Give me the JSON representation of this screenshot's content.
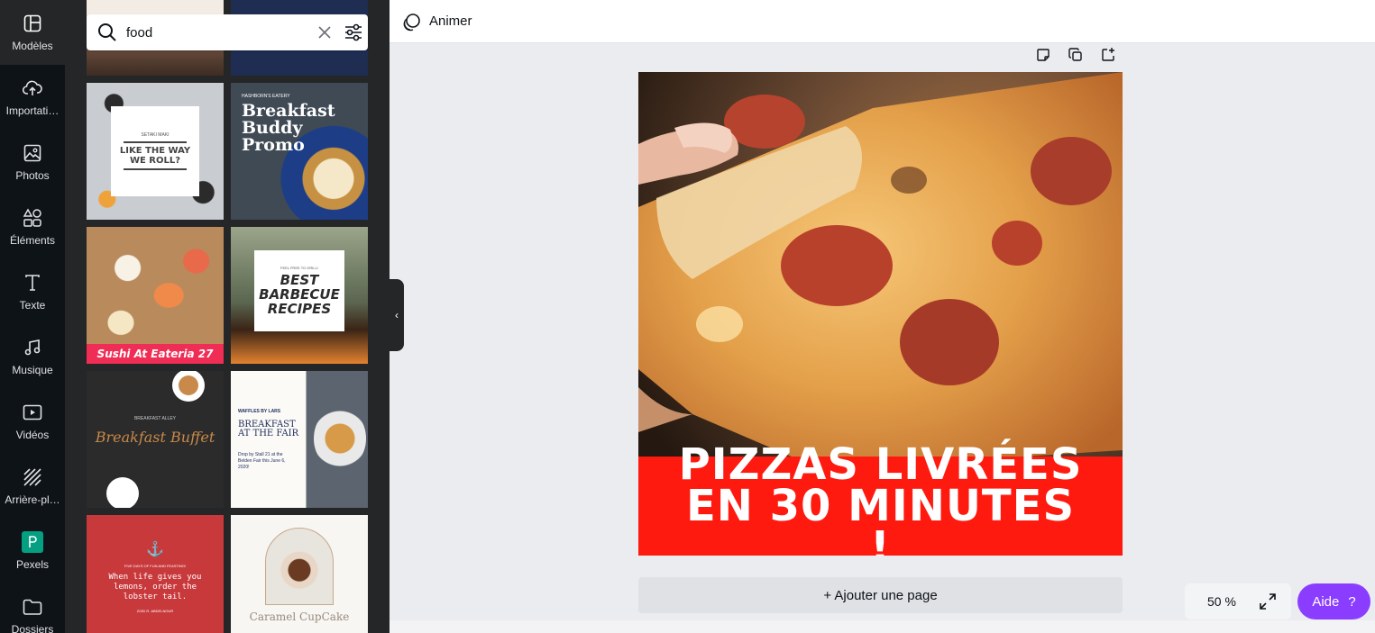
{
  "nav": {
    "items": [
      {
        "label": "Modèles",
        "icon": "templates-icon"
      },
      {
        "label": "Importati…",
        "icon": "upload-cloud-icon"
      },
      {
        "label": "Photos",
        "icon": "image-icon"
      },
      {
        "label": "Éléments",
        "icon": "shapes-icon"
      },
      {
        "label": "Texte",
        "icon": "text-icon"
      },
      {
        "label": "Musique",
        "icon": "music-icon"
      },
      {
        "label": "Vidéos",
        "icon": "video-icon"
      },
      {
        "label": "Arrière-pl…",
        "icon": "background-icon"
      },
      {
        "label": "Pexels",
        "icon": "pexels-icon"
      },
      {
        "label": "Dossiers",
        "icon": "folder-icon"
      }
    ]
  },
  "search": {
    "value": "food"
  },
  "templates": [
    {
      "id": "sushi-roll",
      "kicker": "SETAKI MAKI",
      "title": "LIKE THE WAY WE ROLL?"
    },
    {
      "id": "breakfast-buddy",
      "kicker": "HASHBORN'S EATERY",
      "title": "Breakfast Buddy Promo"
    },
    {
      "id": "sushi-eateria",
      "title": "Sushi At Eateria 27"
    },
    {
      "id": "bbq",
      "kicker": "FEEL FREE TO GRILL!",
      "title": "BEST BARBECUE RECIPES"
    },
    {
      "id": "breakfast-buffet",
      "kicker": "BREAKFAST ALLEY",
      "title": "Breakfast Buffet"
    },
    {
      "id": "waffles",
      "kicker": "WAFFLES BY LARS",
      "title": "BREAKFAST AT THE FAIR",
      "body": "Drop by Stall 21 at the Belden Fair this June 6, 2020!"
    },
    {
      "id": "lobster",
      "kicker": "FIVE DAYS OF FUN AND FEASTING!",
      "title": "When life gives you lemons, order the lobster tail.",
      "footer": "ZOID R. ABDELNOUR"
    },
    {
      "id": "cupcake",
      "title": "Caramel CupCake"
    }
  ],
  "topbar": {
    "animate_label": "Animer"
  },
  "design": {
    "headline": "PIZZAS LIVRÉES EN 30 MINUTES !",
    "banner_color": "#ff1a10"
  },
  "add_page_label": "+ Ajouter une page",
  "zoom": {
    "label": "50 %"
  },
  "help": {
    "label": "Aide",
    "icon": "?"
  },
  "colors": {
    "rail": "#0e1318",
    "panel": "#252627",
    "accent": "#8b3dff"
  }
}
